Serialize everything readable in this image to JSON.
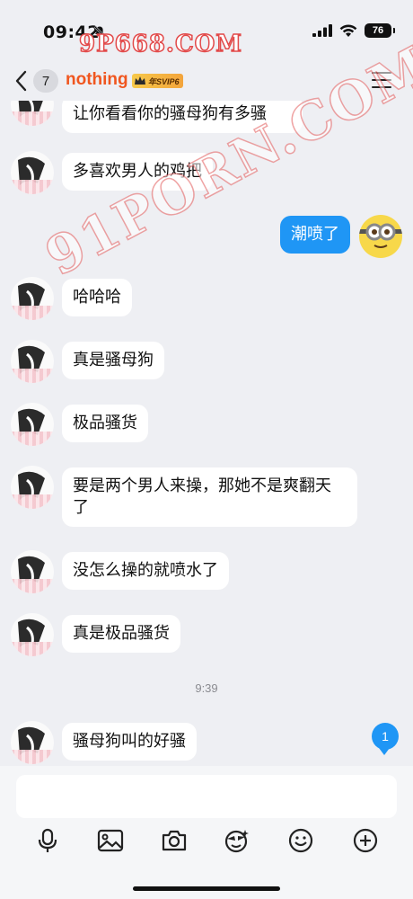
{
  "status_bar": {
    "time": "09:42",
    "battery": "76"
  },
  "watermarks": {
    "top": "9P668.COM",
    "diagonal": "91PORN.COM"
  },
  "header": {
    "unread_count": "7",
    "contact_name": "nothing",
    "vip_label": "年SVIP6"
  },
  "messages": [
    {
      "side": "left",
      "text": "让你看看你的骚母狗有多骚"
    },
    {
      "side": "left",
      "text": "多喜欢男人的鸡把"
    },
    {
      "side": "right",
      "text": "潮喷了"
    },
    {
      "side": "left",
      "text": "哈哈哈"
    },
    {
      "side": "left",
      "text": "真是骚母狗"
    },
    {
      "side": "left",
      "text": "极品骚货"
    },
    {
      "side": "left",
      "text": "要是两个男人来操，那她不是爽翻天了"
    },
    {
      "side": "left",
      "text": "没怎么操的就喷水了"
    },
    {
      "side": "left",
      "text": "真是极品骚货"
    },
    {
      "side": "left",
      "text": "骚母狗叫的好骚"
    }
  ],
  "time_separator": "9:39",
  "new_message_badge": "1",
  "input": {
    "placeholder": ""
  },
  "toolbar": [
    "microphone-icon",
    "image-icon",
    "camera-icon",
    "sticker-icon",
    "emoji-icon",
    "add-icon"
  ],
  "colors": {
    "accent": "#1f96f5",
    "name": "#f0561f",
    "background": "#eeeff3"
  }
}
